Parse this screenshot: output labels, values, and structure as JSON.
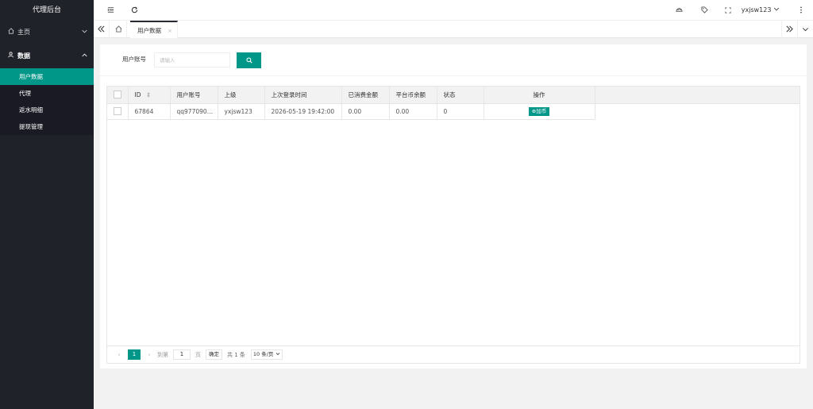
{
  "app": {
    "title": "代理后台"
  },
  "sidebar": {
    "items": [
      {
        "label": "主页",
        "icon": "home-icon",
        "expanded": false
      },
      {
        "label": "数据",
        "icon": "user-data-icon",
        "expanded": true
      }
    ],
    "subitems": [
      {
        "label": "用户数据",
        "active": true
      },
      {
        "label": "代理",
        "active": false
      },
      {
        "label": "返水明细",
        "active": false
      },
      {
        "label": "提现管理",
        "active": false
      }
    ]
  },
  "header": {
    "user_name": "yxjsw123"
  },
  "tabs": {
    "items": [
      {
        "label": "用户数据",
        "close": "×"
      }
    ]
  },
  "search": {
    "label": "用户账号",
    "placeholder": "请输入",
    "button_icon": "search-icon"
  },
  "table": {
    "columns": [
      "ID",
      "用户账号",
      "上级",
      "上次登录时间",
      "已消费金额",
      "平台币余额",
      "状态",
      "操作"
    ],
    "sort_icon": "⇕",
    "rows": [
      {
        "id": "67864",
        "account": "qq977090…",
        "parent": "yxjsw123",
        "last_login": "2026-05-19 19:42:00",
        "spent": "0.00",
        "balance": "0.00",
        "status": "0",
        "action": "⊕加币"
      }
    ]
  },
  "pager": {
    "current": "1",
    "goto_label": "到第",
    "page_value": "1",
    "page_unit": "页",
    "confirm": "确定",
    "total": "共 1 条",
    "page_size": "10 条/页"
  },
  "colors": {
    "accent": "#009688",
    "sidebar_bg": "#20222a",
    "subnav_bg": "#191a23"
  }
}
